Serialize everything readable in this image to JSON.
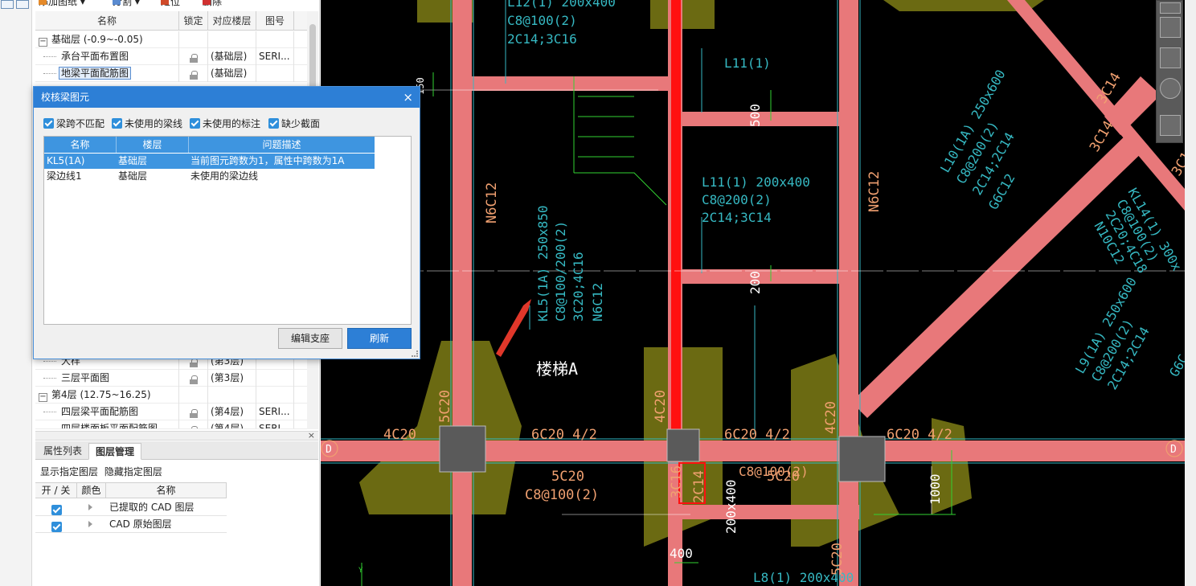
{
  "toolbar": {
    "add_drawing": "添加图纸",
    "split": "分割",
    "locate": "定位",
    "delete": "删除"
  },
  "tree": {
    "columns": [
      "名称",
      "锁定",
      "对应楼层",
      "图号"
    ],
    "rows": [
      {
        "name": "基础层 (-0.9~-0.05)",
        "group": true,
        "lock": false,
        "floor": "",
        "num": ""
      },
      {
        "name": "承台平面布置图",
        "group": false,
        "lock": true,
        "floor": "(基础层)",
        "num": "SERI..."
      },
      {
        "name": "地梁平面配筋图",
        "group": false,
        "lock": true,
        "floor": "(基础层)",
        "num": "",
        "selected": true
      },
      {
        "name": "大样",
        "group": false,
        "lock": true,
        "floor": "(第3层)",
        "num": ""
      },
      {
        "name": "三层平面图",
        "group": false,
        "lock": true,
        "floor": "(第3层)",
        "num": ""
      },
      {
        "name": "第4层 (12.75~16.25)",
        "group": true,
        "lock": false,
        "floor": "",
        "num": ""
      },
      {
        "name": "四层梁平面配筋图",
        "group": false,
        "lock": true,
        "floor": "(第4层)",
        "num": "SERI..."
      },
      {
        "name": "四层楼面板平面配筋图",
        "group": false,
        "lock": true,
        "floor": "(第4层)",
        "num": "SERI..."
      }
    ]
  },
  "dock": {
    "close": "×",
    "tabs": [
      "属性列表",
      "图层管理"
    ],
    "active_tab": "图层管理",
    "links": [
      "显示指定图层",
      "隐藏指定图层"
    ],
    "layer_columns": [
      "开 / 关",
      "颜色",
      "名称"
    ],
    "layers": [
      {
        "on": true,
        "name": "已提取的 CAD 图层"
      },
      {
        "on": true,
        "name": "CAD 原始图层"
      }
    ]
  },
  "dialog": {
    "title": "校核梁图元",
    "close": "×",
    "filters": [
      {
        "label": "梁跨不匹配",
        "checked": true
      },
      {
        "label": "未使用的梁线",
        "checked": true
      },
      {
        "label": "未使用的标注",
        "checked": true
      },
      {
        "label": "缺少截面",
        "checked": true
      }
    ],
    "columns": [
      "名称",
      "楼层",
      "问题描述"
    ],
    "rows": [
      {
        "name": "KL5(1A)",
        "floor": "基础层",
        "desc": "当前图元跨数为1，属性中跨数为1A",
        "selected": true
      },
      {
        "name": "梁边线1",
        "floor": "基础层",
        "desc": "未使用的梁边线",
        "selected": false
      }
    ],
    "edit_support_button": "编辑支座",
    "refresh_button": "刷新"
  },
  "cad_labels": {
    "top_beam_1": "L12(1) 200x400",
    "top_beam_2": "C8@100(2)",
    "top_beam_3": "2C14;3C16",
    "l11_top": "L11(1)",
    "dim_500": "500",
    "l11_1": "L11(1) 200x400",
    "l11_2": "C8@200(2)",
    "l11_3": "2C14;3C14",
    "dim_200": "200",
    "n6c12_left": "N6C12",
    "n6c12_right": "N6C12",
    "kl5_1": "KL5(1A) 250x850",
    "kl5_2": "C8@100/200(2)",
    "kl5_3": "3C20;4C16",
    "kl5_4": "N6C12",
    "stair": "楼梯A",
    "l10_1": "L10(1A) 250x600",
    "l10_2": "C8@200(2)",
    "l10_3": "2C14;2C14",
    "l10_4": "G6C12",
    "l14_1": "KL14(1) 300x",
    "l14_2": "C8@100(2)",
    "l14_3": "2C20;4C18",
    "l14_4": "N10C12",
    "l9_1": "L9(1A) 250x600",
    "l9_2": "C8@200(2)",
    "l9_3": "2C14;2C14",
    "l9_4": "G6C",
    "diag_3c14a": "3C14",
    "diag_3c14b": "3C14",
    "diag_3c14c": "3C14",
    "d_label": "D",
    "b_4c20": "4C20",
    "b_5c20a": "5C20",
    "b_6c20a": "6C20 4/2",
    "b_4c20v": "4C20",
    "b_6c20b": "6C20 4/2",
    "b_4c20v2": "4C20",
    "b_6c20c": "6C20 4/2",
    "b_5c20b": "5C20",
    "b_c8a": "C8@100(2)",
    "b_5c20c": "5C20",
    "b_c8b": "C8@100(2)",
    "b_3c16": "3C16",
    "b_2c14": "2C14",
    "b_200x400": "200x400",
    "dim_1000": "1000",
    "dim_400": "400",
    "b_5c20v": "5C20",
    "l8": "L8(1) 200x400",
    "axis_y": "Y",
    "dim_1_top": "150"
  },
  "colors": {
    "beam_fill": "#e8787a",
    "beam_red": "#ff1010",
    "olive": "#6b6a12",
    "cyan": "#36b9c3",
    "cad_text": "#f0a070",
    "column": "#5a5a5a",
    "dialog_accent": "#2d7fd6"
  }
}
